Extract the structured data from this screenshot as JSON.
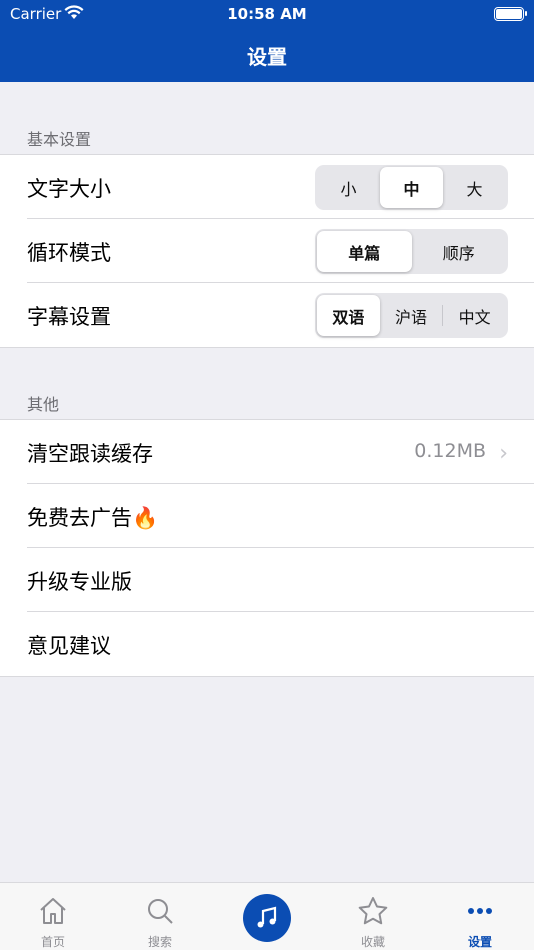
{
  "status": {
    "carrier": "Carrier",
    "time": "10:58 AM"
  },
  "nav": {
    "title": "设置"
  },
  "basic": {
    "header": "基本设置",
    "font_size": {
      "label": "文字大小",
      "options": [
        "小",
        "中",
        "大"
      ],
      "selected": "中"
    },
    "loop_mode": {
      "label": "循环模式",
      "options": [
        "单篇",
        "顺序"
      ],
      "selected": "单篇"
    },
    "subtitle": {
      "label": "字幕设置",
      "options": [
        "双语",
        "沪语",
        "中文"
      ],
      "selected": "双语"
    }
  },
  "other": {
    "header": "其他",
    "clear_cache": {
      "label": "清空跟读缓存",
      "value": "0.12MB"
    },
    "remove_ads": {
      "label": "免费去广告🔥"
    },
    "upgrade": {
      "label": "升级专业版"
    },
    "feedback": {
      "label": "意见建议"
    }
  },
  "tabbar": {
    "home": "首页",
    "search": "搜索",
    "favorites": "收藏",
    "settings": "设置"
  },
  "colors": {
    "accent": "#0b4db3",
    "background": "#efeff4"
  },
  "icons": {
    "home": "home-icon",
    "search": "search-icon",
    "music": "music-note-icon",
    "star": "star-icon",
    "more": "more-dots-icon"
  }
}
